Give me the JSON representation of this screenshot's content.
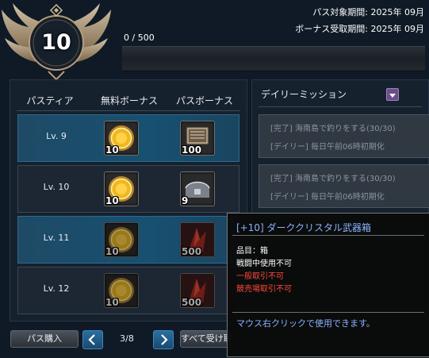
{
  "header": {
    "level": "10",
    "exp_text": "0 / 500",
    "exp_progress": 0.0,
    "pass_period": "パス対象期間: 2025年 09月",
    "bonus_period": "ボーナス受取期間: 2025年 09月"
  },
  "table": {
    "columns": [
      "パスティア",
      "無料ボーナス",
      "パスボーナス"
    ],
    "rows": [
      {
        "level": "Lv. 9",
        "free_qty": "10",
        "pass_qty": "100",
        "pass_icon": "scroll-icon",
        "highlighted": true
      },
      {
        "level": "Lv. 10",
        "free_qty": "10",
        "pass_qty": "9",
        "pass_icon": "chest-icon",
        "highlighted": false
      },
      {
        "level": "Lv. 11",
        "free_qty": "10",
        "pass_qty": "500",
        "pass_icon": "crystal-icon",
        "highlighted": true
      },
      {
        "level": "Lv. 12",
        "free_qty": "10",
        "pass_qty": "500",
        "pass_icon": "crystal-icon",
        "highlighted": false
      }
    ]
  },
  "footer": {
    "buy_label": "パス購入",
    "page_indicator": "3/8",
    "receive_all_label": "すべて受け取る"
  },
  "daily": {
    "title": "デイリーミッション",
    "missions": [
      {
        "status": "[完了] 海南島で釣りをする(30/30)",
        "reset": "[デイリー] 毎日午前06時初期化"
      },
      {
        "status": "[完了] 海南島で釣りをする(30/30)",
        "reset": "[デイリー] 毎日午前06時初期化"
      }
    ]
  },
  "tooltip": {
    "title": "[+10] ダーククリスタル武器箱",
    "item_type": "品目：箱",
    "combat": "戦闘中使用不可",
    "trade": "一般取引不可",
    "auction": "競売場取引不可",
    "usage": "マウス右クリックで使用できます。"
  },
  "colors": {
    "accent_blue": "#175071",
    "tooltip_title": "#8ab4ff",
    "restriction_red": "#ff4a3d",
    "gold": "#c9a24a"
  }
}
